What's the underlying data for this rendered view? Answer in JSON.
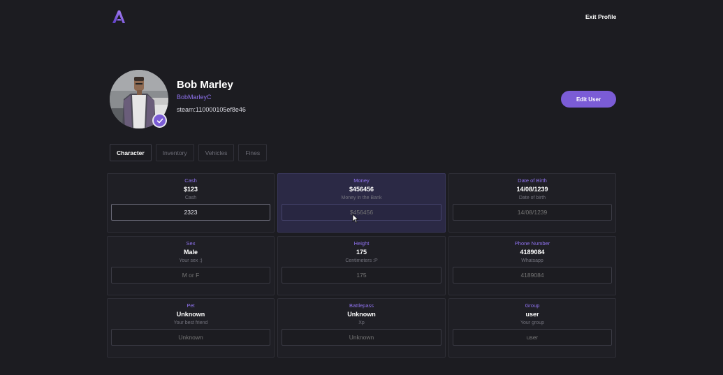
{
  "header": {
    "exit_label": "Exit Profile"
  },
  "profile": {
    "name": "Bob Marley",
    "username": "BobMarleyC",
    "steam_id": "steam:110000105ef8e46",
    "edit_label": "Edit User"
  },
  "tabs": [
    {
      "label": "Character",
      "active": true
    },
    {
      "label": "Inventory",
      "active": false
    },
    {
      "label": "Vehicles",
      "active": false
    },
    {
      "label": "Fines",
      "active": false
    }
  ],
  "cards": [
    {
      "label": "Cash",
      "value": "$123",
      "desc": "Cash",
      "input_value": "2323",
      "placeholder": ""
    },
    {
      "label": "Money",
      "value": "$456456",
      "desc": "Money in the Bank",
      "input_value": "",
      "placeholder": "$456456"
    },
    {
      "label": "Date of Birth",
      "value": "14/08/1239",
      "desc": "Date of birth",
      "input_value": "",
      "placeholder": "14/08/1239"
    },
    {
      "label": "Sex",
      "value": "Male",
      "desc": "Your sex :)",
      "input_value": "",
      "placeholder": "M or F"
    },
    {
      "label": "Height",
      "value": "175",
      "desc": "Centimeters :P",
      "input_value": "",
      "placeholder": "175"
    },
    {
      "label": "Phone Number",
      "value": "4189084",
      "desc": "Whatsapp",
      "input_value": "",
      "placeholder": "4189084"
    },
    {
      "label": "Pet",
      "value": "Unknown",
      "desc": "Your best friend",
      "input_value": "",
      "placeholder": "Unknown"
    },
    {
      "label": "Battlepass",
      "value": "Unknown",
      "desc": "Xp",
      "input_value": "",
      "placeholder": "Unknown"
    },
    {
      "label": "Group",
      "value": "user",
      "desc": "Your group",
      "input_value": "",
      "placeholder": "user"
    }
  ],
  "colors": {
    "accent": "#7b5cd6",
    "background": "#1c1c21",
    "label": "#8f72ee"
  },
  "icons": {
    "logo": "brand-logo-icon",
    "verified": "check-icon"
  }
}
